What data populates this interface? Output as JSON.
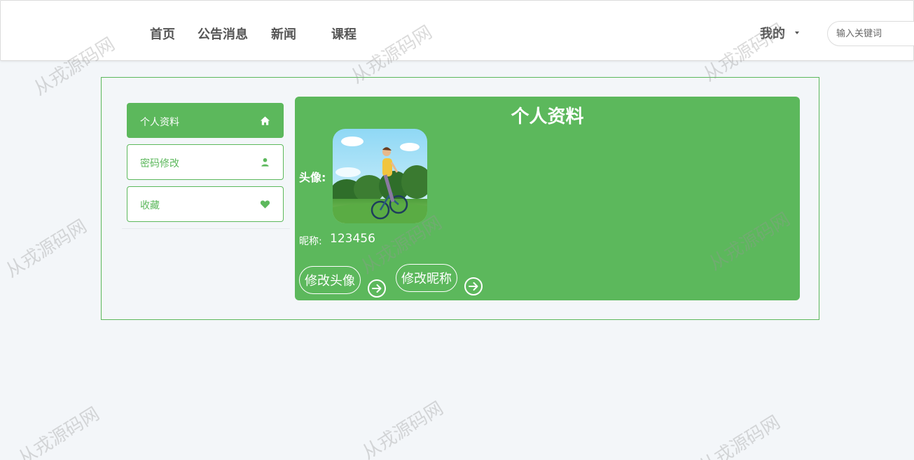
{
  "header": {
    "nav": [
      "首页",
      "公告消息",
      "新闻",
      "课程"
    ],
    "mine_label": "我的",
    "search_placeholder": "输入关键词"
  },
  "sidebar": {
    "items": [
      {
        "label": "个人资料",
        "icon": "home-icon",
        "active": true
      },
      {
        "label": "密码修改",
        "icon": "user-icon",
        "active": false
      },
      {
        "label": "收藏",
        "icon": "heart-icon",
        "active": false
      }
    ]
  },
  "profile": {
    "title": "个人资料",
    "avatar_label": "头像:",
    "nickname_label": "昵称:",
    "nickname_value": "123456",
    "change_avatar_label": "修改头像",
    "change_nickname_label": "修改昵称"
  },
  "watermark": "从戎源码网",
  "colors": {
    "accent": "#5cb85c",
    "background": "#f3f6f9"
  }
}
